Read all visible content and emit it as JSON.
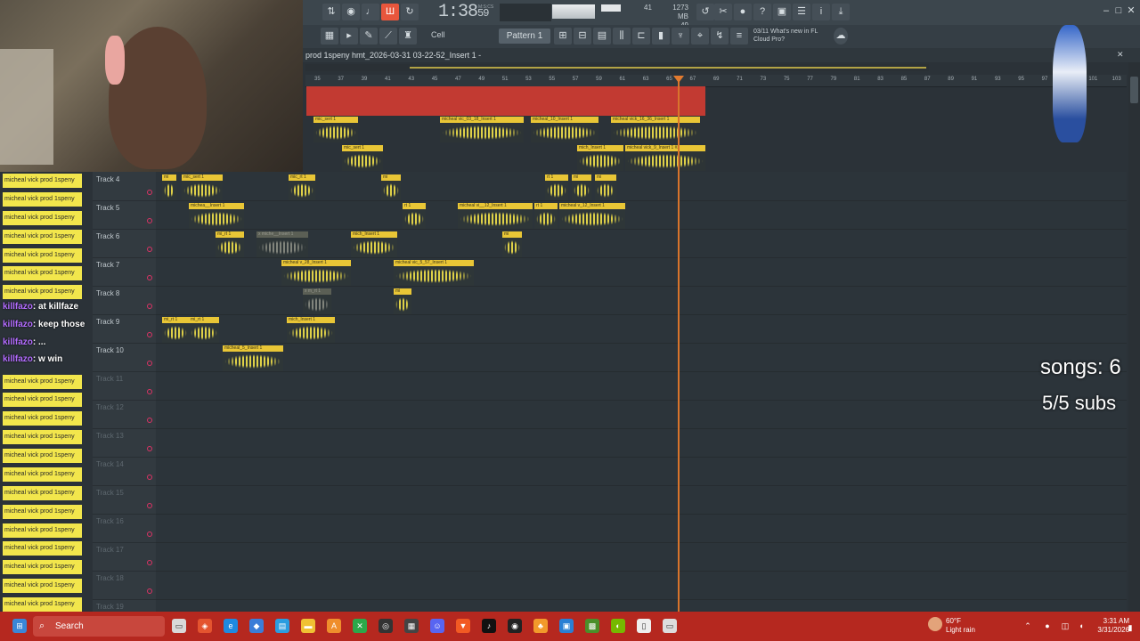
{
  "webcam": {
    "label": "streamer webcam"
  },
  "toolbar": {
    "time": "1:38",
    "time_fraction": "59",
    "time_unit": "M:S:CS",
    "cpu": "41",
    "mem": "1273 MB",
    "mem_sub": "49",
    "snap": "Cell",
    "pattern": "Pattern 1",
    "news_line1": "03/11 What's new in FL",
    "news_line2": "Cloud Pro?"
  },
  "playlist": {
    "title": "prod 1speny hmt_2026-03-31 03-22-52_Insert 1 -",
    "ruler": [
      "35",
      "37",
      "39",
      "41",
      "43",
      "45",
      "47",
      "49",
      "51",
      "53",
      "55",
      "57",
      "59",
      "61",
      "63",
      "65",
      "67",
      "69",
      "71",
      "73",
      "75",
      "77",
      "79",
      "81",
      "83",
      "85",
      "87",
      "89",
      "91",
      "93",
      "95",
      "97",
      "99",
      "101",
      "103"
    ],
    "tracks": [
      "Track 4",
      "Track 5",
      "Track 6",
      "Track 7",
      "Track 8",
      "Track 9",
      "Track 10",
      "Track 11",
      "Track 12",
      "Track 13",
      "Track 14",
      "Track 15",
      "Track 16",
      "Track 17",
      "Track 18",
      "Track 19"
    ],
    "clips": {
      "m1": "mic_sert 1",
      "m2": "micheal vic_03_18_Insert 1",
      "m3": "micheal_10_Insert 1",
      "m4": "micheal vick_16_36_Insert 1",
      "m5": "mic_sert 1",
      "m6": "mich_Insert 1",
      "m7": "micheal vick_9_Insert 1 #2",
      "t4a": "mi",
      "t4b": "mic_sert 1",
      "t4c": "mic_rt 1",
      "t4d": "mi",
      "t4e": "rt 1",
      "t4f": "mi",
      "t4g": "mi",
      "t5a": "michea__Insert 1",
      "t5b": "rt 1",
      "t5c": "micheal vi__12_Insert 1",
      "t5d": "rt 1",
      "t5e": "micheal v_12_Insert 1",
      "t6a": "mi_rt 1",
      "t6b": "x miche__Insert 1",
      "t6c": "mich_Insert 1",
      "t6d": "mi",
      "t7a": "micheal v_28_Insert 1",
      "t7b": "micheal vic_5_57_Insert 1",
      "t8a": "x m_rt 1",
      "t8b": "mi",
      "t9a": "mi_rt 1",
      "t9b": "mi_rt 1",
      "t9c": "mich_Insert 1",
      "t10a": "micheal_5_Insert 1"
    }
  },
  "chat": {
    "line": "micheal vick prod 1speny",
    "msg1_user": "killfazo",
    "msg1_text": ": at killfaze",
    "msg2_user": "killfazo",
    "msg2_text": ": keep those",
    "msg3_user": "killfazo",
    "msg3_text": ": ...",
    "msg4_user": "killfazo",
    "msg4_text": ": w win"
  },
  "overlay": {
    "songs": "songs: 6",
    "subs": "5/5 subs"
  },
  "taskbar": {
    "search": "Search",
    "weather_temp": "60°F",
    "weather_desc": "Light rain",
    "time": "3:31 AM",
    "date": "3/31/2026"
  },
  "colors": {
    "accent": "#e9c636",
    "taskbar": "#b5281f",
    "playhead": "#d8742c"
  }
}
